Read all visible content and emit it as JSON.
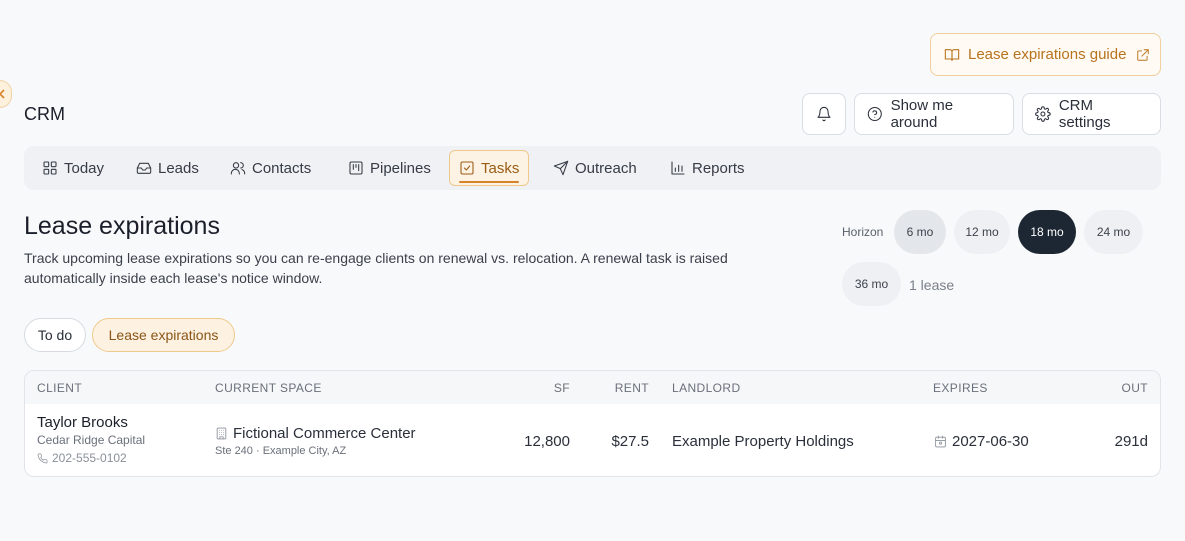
{
  "header": {
    "guide_label": "Lease expirations guide",
    "app_title": "CRM",
    "tour_label": "Show me around",
    "settings_label": "CRM settings"
  },
  "tabs": [
    {
      "label": "Today",
      "icon": "grid-icon"
    },
    {
      "label": "Leads",
      "icon": "inbox-icon"
    },
    {
      "label": "Contacts",
      "icon": "users-icon"
    },
    {
      "label": "Pipelines",
      "icon": "kanban-icon"
    },
    {
      "label": "Tasks",
      "icon": "checkbox-icon",
      "active": true
    },
    {
      "label": "Outreach",
      "icon": "send-icon"
    },
    {
      "label": "Reports",
      "icon": "bar-chart-icon"
    }
  ],
  "page": {
    "title": "Lease expirations",
    "description": "Track upcoming lease expirations so you can re-engage clients on renewal vs. relocation. A renewal task is raised automatically inside each lease's notice window."
  },
  "horizon": {
    "label": "Horizon",
    "options": [
      "6 mo",
      "12 mo",
      "18 mo",
      "24 mo",
      "36 mo"
    ],
    "selected": "18 mo",
    "count_text": "1 lease"
  },
  "filters": {
    "todo_label": "To do",
    "lease_label": "Lease expirations"
  },
  "table": {
    "columns": [
      "CLIENT",
      "CURRENT SPACE",
      "SF",
      "RENT",
      "LANDLORD",
      "EXPIRES",
      "OUT"
    ],
    "rows": [
      {
        "client_name": "Taylor Brooks",
        "client_company": "Cedar Ridge Capital",
        "client_phone": "202-555-0102",
        "space_name": "Fictional Commerce Center",
        "space_detail": "Ste 240 · Example City, AZ",
        "sf": "12,800",
        "rent": "$27.5",
        "landlord": "Example Property Holdings",
        "expires": "2027-06-30",
        "out": "291d"
      }
    ]
  },
  "colors": {
    "accent": "#d8832a",
    "accent_text": "#b8731d",
    "dark_pill": "#1d2733"
  }
}
